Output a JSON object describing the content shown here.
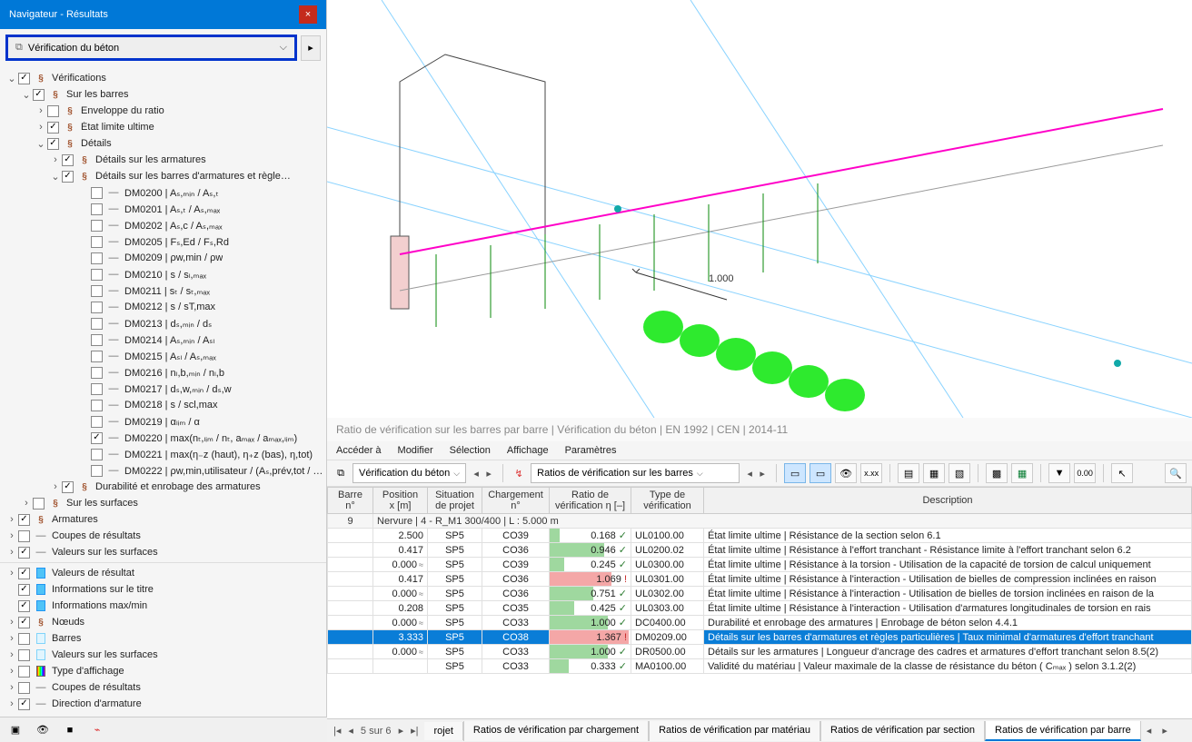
{
  "navigator": {
    "title": "Navigateur - Résultats",
    "dropdown_label": "Vérification du béton",
    "tree": [
      {
        "ind": 0,
        "tw": "v",
        "cb": true,
        "ic": "code",
        "label": "Vérifications"
      },
      {
        "ind": 1,
        "tw": "v",
        "cb": true,
        "ic": "code",
        "label": "Sur les barres"
      },
      {
        "ind": 2,
        "tw": ">",
        "cb": false,
        "ic": "code",
        "label": "Enveloppe du ratio"
      },
      {
        "ind": 2,
        "tw": ">",
        "cb": true,
        "ic": "code",
        "label": "État limite ultime"
      },
      {
        "ind": 2,
        "tw": "v",
        "cb": true,
        "ic": "code",
        "label": "Détails"
      },
      {
        "ind": 3,
        "tw": ">",
        "cb": true,
        "ic": "code",
        "label": "Détails sur les armatures"
      },
      {
        "ind": 3,
        "tw": "v",
        "cb": true,
        "ic": "code",
        "label": "Détails sur les barres d'armatures et règle…"
      },
      {
        "ind": 5,
        "tw": " ",
        "cb": false,
        "ic": "dash",
        "label": "DM0200 | Aₛ,ₘᵢₙ / Aₛ,ₜ"
      },
      {
        "ind": 5,
        "tw": " ",
        "cb": false,
        "ic": "dash",
        "label": "DM0201 | Aₛ,ₜ / Aₛ,ₘₐₓ"
      },
      {
        "ind": 5,
        "tw": " ",
        "cb": false,
        "ic": "dash",
        "label": "DM0202 | Aₛ,c / Aₛ,ₘₐₓ"
      },
      {
        "ind": 5,
        "tw": " ",
        "cb": false,
        "ic": "dash",
        "label": "DM0205 | Fₛ,Ed / Fₛ,Rd"
      },
      {
        "ind": 5,
        "tw": " ",
        "cb": false,
        "ic": "dash",
        "label": "DM0209 | ρw,min / ρw"
      },
      {
        "ind": 5,
        "tw": " ",
        "cb": false,
        "ic": "dash",
        "label": "DM0210 | s / sₗ,ₘₐₓ"
      },
      {
        "ind": 5,
        "tw": " ",
        "cb": false,
        "ic": "dash",
        "label": "DM0211 | sₜ / sₜ,ₘₐₓ"
      },
      {
        "ind": 5,
        "tw": " ",
        "cb": false,
        "ic": "dash",
        "label": "DM0212 | s / sT,max"
      },
      {
        "ind": 5,
        "tw": " ",
        "cb": false,
        "ic": "dash",
        "label": "DM0213 | dₛ,ₘᵢₙ / dₛ"
      },
      {
        "ind": 5,
        "tw": " ",
        "cb": false,
        "ic": "dash",
        "label": "DM0214 | Aₛ,ₘᵢₙ / Aₛₗ"
      },
      {
        "ind": 5,
        "tw": " ",
        "cb": false,
        "ic": "dash",
        "label": "DM0215 | Aₛₗ / Aₛ,ₘₐₓ"
      },
      {
        "ind": 5,
        "tw": " ",
        "cb": false,
        "ic": "dash",
        "label": "DM0216 | nₗ,b,ₘᵢₙ / nₗ,b"
      },
      {
        "ind": 5,
        "tw": " ",
        "cb": false,
        "ic": "dash",
        "label": "DM0217 | dₛ,w,ₘᵢₙ / dₛ,w"
      },
      {
        "ind": 5,
        "tw": " ",
        "cb": false,
        "ic": "dash",
        "label": "DM0218 | s / scl,max"
      },
      {
        "ind": 5,
        "tw": " ",
        "cb": false,
        "ic": "dash",
        "label": "DM0219 | αₗᵢₘ / α"
      },
      {
        "ind": 5,
        "tw": " ",
        "cb": true,
        "ic": "dash",
        "label": "DM0220 | max(nₜ,ₗᵢₘ / nₜ, aₘₐₓ / aₘₐₓ,ₗᵢₘ)"
      },
      {
        "ind": 5,
        "tw": " ",
        "cb": false,
        "ic": "dash",
        "label": "DM0221 | max(η₋z (haut), η₊z (bas), η,tot)"
      },
      {
        "ind": 5,
        "tw": " ",
        "cb": false,
        "ic": "dash",
        "label": "DM0222 | ρw,min,utilisateur / (Aₛ,prév,tot / …"
      },
      {
        "ind": 3,
        "tw": ">",
        "cb": true,
        "ic": "code",
        "label": "Durabilité et enrobage des armatures"
      },
      {
        "ind": 1,
        "tw": ">",
        "cb": false,
        "ic": "code",
        "label": "Sur les surfaces"
      },
      {
        "ind": 0,
        "tw": ">",
        "cb": true,
        "ic": "code",
        "label": "Armatures"
      },
      {
        "ind": 0,
        "tw": ">",
        "cb": false,
        "ic": "dash",
        "label": "Coupes de résultats"
      },
      {
        "ind": 0,
        "tw": ">",
        "cb": true,
        "ic": "dash",
        "label": "Valeurs sur les surfaces"
      }
    ],
    "tree2": [
      {
        "ind": 0,
        "tw": ">",
        "cb": true,
        "ic": "cyan",
        "label": "Valeurs de résultat"
      },
      {
        "ind": 0,
        "tw": " ",
        "cb": true,
        "ic": "cyan",
        "label": "Informations sur le titre"
      },
      {
        "ind": 0,
        "tw": " ",
        "cb": true,
        "ic": "cyan",
        "label": "Informations max/min"
      },
      {
        "ind": 0,
        "tw": ">",
        "cb": true,
        "ic": "code",
        "label": "Nœuds"
      },
      {
        "ind": 0,
        "tw": ">",
        "cb": false,
        "ic": "pale",
        "label": "Barres"
      },
      {
        "ind": 0,
        "tw": ">",
        "cb": false,
        "ic": "pale",
        "label": "Valeurs sur les surfaces"
      },
      {
        "ind": 0,
        "tw": ">",
        "cb": false,
        "ic": "rain",
        "label": "Type d'affichage"
      },
      {
        "ind": 0,
        "tw": ">",
        "cb": false,
        "ic": "dash",
        "label": "Coupes de résultats"
      },
      {
        "ind": 0,
        "tw": ">",
        "cb": true,
        "ic": "dash",
        "label": "Direction d'armature"
      }
    ]
  },
  "viewport": {
    "dim_label": "1.000"
  },
  "results": {
    "title": "Ratio de vérification sur les barres par barre | Vérification du béton | EN 1992 | CEN | 2014-11",
    "menus": [
      "Accéder à",
      "Modifier",
      "Sélection",
      "Affichage",
      "Paramètres"
    ],
    "dd1": "Vérification du béton",
    "dd2": "Ratios de vérification sur les barres",
    "headers": {
      "barre": "Barre\nn°",
      "pos": "Position\nx [m]",
      "sit": "Situation\nde projet",
      "charg": "Chargement\nn°",
      "ratio": "Ratio de\nvérification η [–]",
      "type": "Type de\nvérification",
      "desc": "Description"
    },
    "group_row": {
      "barre": "9",
      "label": "Nervure | 4 - R_M1 300/400 | L : 5.000 m"
    },
    "rows": [
      {
        "pos": "2.500",
        "approx": "",
        "sit": "SP5",
        "charg": "CO39",
        "ratio": 0.168,
        "ok": true,
        "type": "UL0100.00",
        "desc": "État limite ultime | Résistance de la section selon 6.1"
      },
      {
        "pos": "0.417",
        "approx": "",
        "sit": "SP5",
        "charg": "CO36",
        "ratio": 0.946,
        "ok": true,
        "type": "UL0200.02",
        "desc": "État limite ultime | Résistance à l'effort tranchant - Résistance limite à l'effort tranchant selon 6.2"
      },
      {
        "pos": "0.000",
        "approx": "≈",
        "sit": "SP5",
        "charg": "CO39",
        "ratio": 0.245,
        "ok": true,
        "type": "UL0300.00",
        "desc": "État limite ultime | Résistance à la torsion - Utilisation de la capacité de torsion de calcul uniquement"
      },
      {
        "pos": "0.417",
        "approx": "",
        "sit": "SP5",
        "charg": "CO36",
        "ratio": 1.069,
        "ok": false,
        "type": "UL0301.00",
        "desc": "État limite ultime | Résistance à l'interaction - Utilisation de bielles de compression inclinées en raison"
      },
      {
        "pos": "0.000",
        "approx": "≈",
        "sit": "SP5",
        "charg": "CO36",
        "ratio": 0.751,
        "ok": true,
        "type": "UL0302.00",
        "desc": "État limite ultime | Résistance à l'interaction - Utilisation de bielles de torsion inclinées en raison de la"
      },
      {
        "pos": "0.208",
        "approx": "",
        "sit": "SP5",
        "charg": "CO35",
        "ratio": 0.425,
        "ok": true,
        "type": "UL0303.00",
        "desc": "État limite ultime | Résistance à l'interaction - Utilisation d'armatures longitudinales de torsion en rais"
      },
      {
        "pos": "0.000",
        "approx": "≈",
        "sit": "SP5",
        "charg": "CO33",
        "ratio": 1.0,
        "ok": true,
        "type": "DC0400.00",
        "desc": "Durabilité et enrobage des armatures | Enrobage de béton selon 4.4.1"
      },
      {
        "sel": true,
        "pos": "3.333",
        "approx": "",
        "sit": "SP5",
        "charg": "CO38",
        "ratio": 1.367,
        "ok": false,
        "type": "DM0209.00",
        "desc": "Détails sur les barres d'armatures et règles particulières | Taux minimal d'armatures d'effort tranchant"
      },
      {
        "pos": "0.000",
        "approx": "≈",
        "sit": "SP5",
        "charg": "CO33",
        "ratio": 1.0,
        "ok": true,
        "type": "DR0500.00",
        "desc": "Détails sur les armatures | Longueur d'ancrage des cadres et armatures d'effort tranchant selon 8.5(2)"
      },
      {
        "pos": "",
        "approx": "",
        "sit": "SP5",
        "charg": "CO33",
        "ratio": 0.333,
        "ok": true,
        "type": "MA0100.00",
        "desc": "Validité du matériau | Valeur maximale de la classe de résistance du béton ( Cₘₐₓ ) selon 3.1.2(2)"
      }
    ],
    "pagenav": {
      "text": "5 sur 6",
      "first_tab": "rojet"
    },
    "tabs": [
      {
        "label": "Ratios de vérification par chargement",
        "active": false
      },
      {
        "label": "Ratios de vérification par matériau",
        "active": false
      },
      {
        "label": "Ratios de vérification par section",
        "active": false
      },
      {
        "label": "Ratios de vérification par barre",
        "active": true
      }
    ]
  }
}
